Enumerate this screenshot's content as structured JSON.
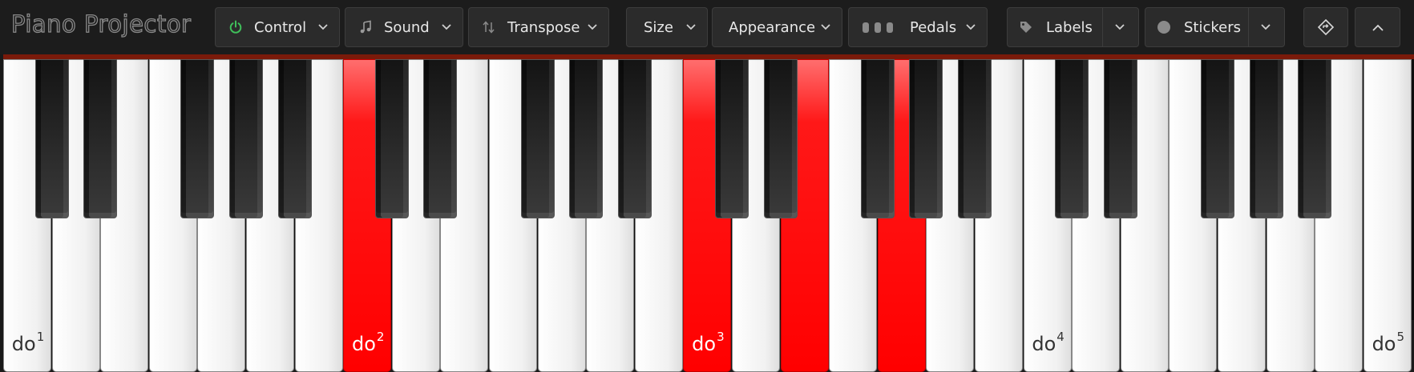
{
  "app": {
    "title": "Piano Projector"
  },
  "toolbar": {
    "control": {
      "label": "Control",
      "icon": "power-icon",
      "color": "#3fbf5a"
    },
    "sound": {
      "label": "Sound",
      "icon": "music-note-icon"
    },
    "transpose": {
      "label": "Transpose",
      "icon": "up-down-arrows-icon"
    },
    "size": {
      "label": "Size"
    },
    "appearance": {
      "label": "Appearance"
    },
    "pedals": {
      "label": "Pedals",
      "icon": "pedals-icon"
    },
    "labels": {
      "label": "Labels",
      "icon": "tag-icon"
    },
    "stickers": {
      "label": "Stickers",
      "icon": "dot-icon"
    },
    "fullscreen": {
      "icon": "diamond-arrows-icon"
    },
    "collapse": {
      "icon": "chevron-up-icon"
    }
  },
  "piano": {
    "white_key_count": 29,
    "black_key_indices": [
      0,
      1,
      3,
      4,
      5,
      7,
      8,
      10,
      11,
      12,
      14,
      15,
      17,
      18,
      19,
      21,
      22,
      24,
      25,
      26
    ],
    "pressed_white_keys": [
      7,
      14,
      16,
      18
    ],
    "pressed_black_keys": [],
    "pressed_color": "#ff0000",
    "labels": [
      {
        "key": 0,
        "name": "do",
        "octave": "1"
      },
      {
        "key": 7,
        "name": "do",
        "octave": "2"
      },
      {
        "key": 14,
        "name": "do",
        "octave": "3"
      },
      {
        "key": 21,
        "name": "do",
        "octave": "4"
      },
      {
        "key": 28,
        "name": "do",
        "octave": "5"
      }
    ]
  }
}
